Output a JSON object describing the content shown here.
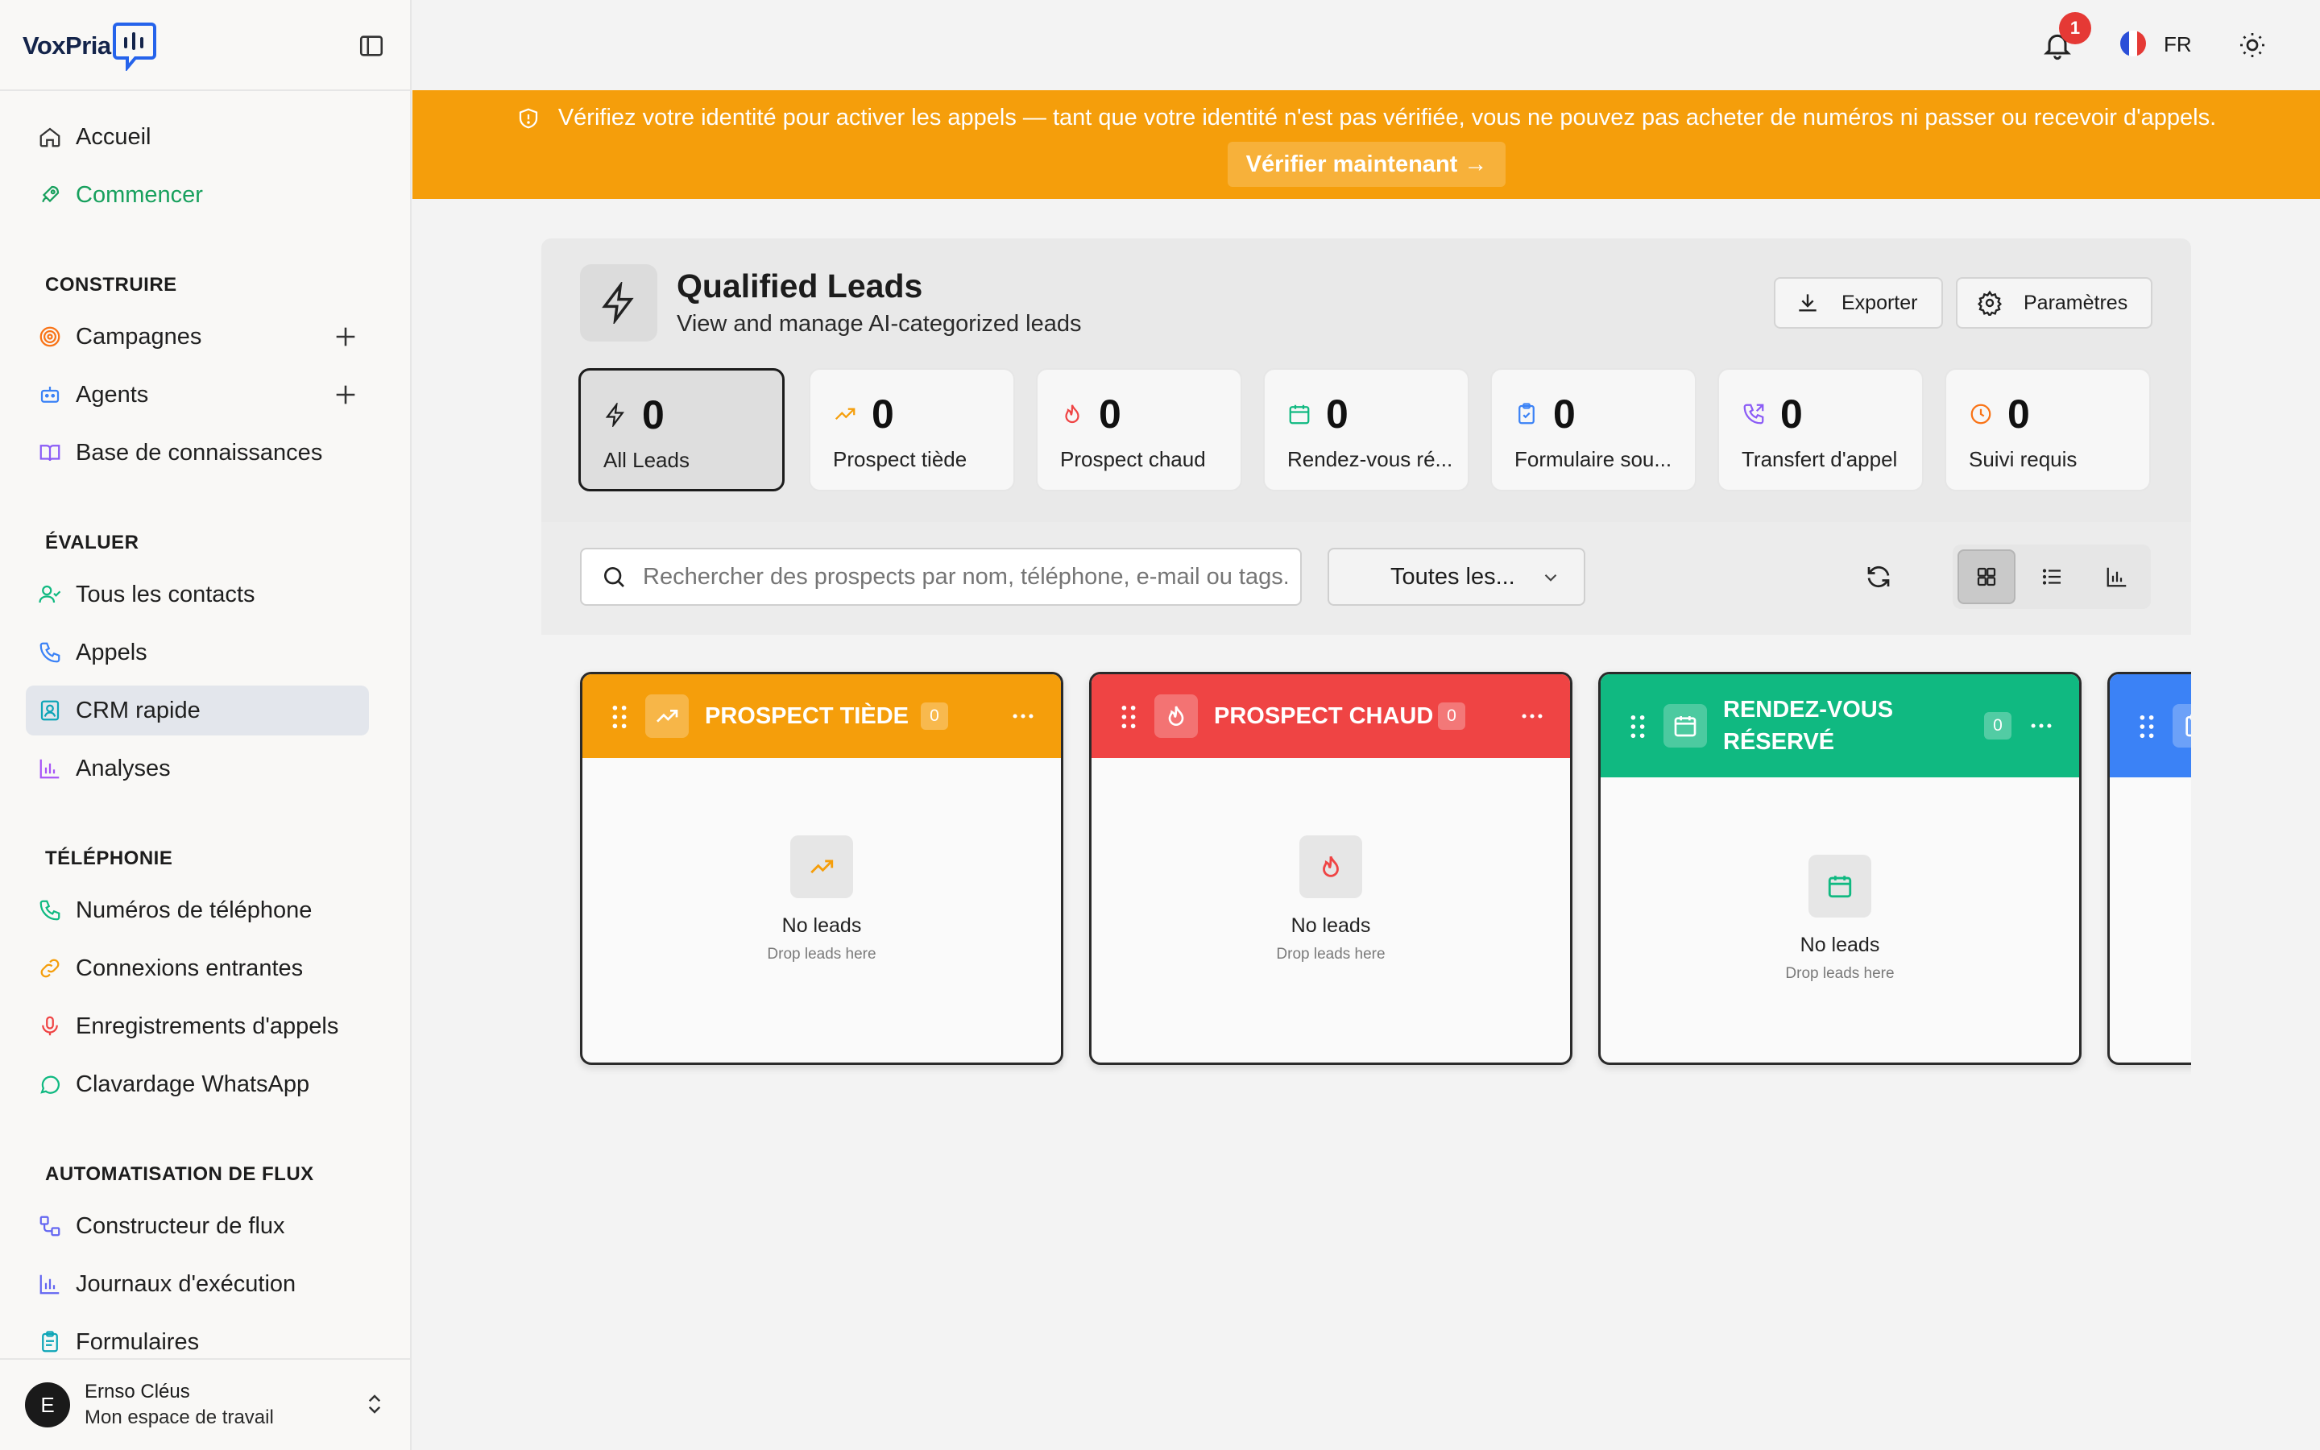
{
  "app": {
    "name": "VoxPria"
  },
  "sidebar": {
    "items_top": [
      {
        "label": "Accueil",
        "icon": "home-icon"
      },
      {
        "label": "Commencer",
        "icon": "rocket-icon"
      }
    ],
    "sections": [
      {
        "title": "CONSTRUIRE",
        "items": [
          {
            "label": "Campagnes",
            "icon": "target-icon"
          },
          {
            "label": "Agents",
            "icon": "bot-icon"
          },
          {
            "label": "Base de connaissances",
            "icon": "book-icon"
          }
        ]
      },
      {
        "title": "ÉVALUER",
        "items": [
          {
            "label": "Tous les contacts",
            "icon": "user-check-icon"
          },
          {
            "label": "Appels",
            "icon": "phone-icon"
          },
          {
            "label": "CRM rapide",
            "icon": "contact-card-icon"
          },
          {
            "label": "Analyses",
            "icon": "bar-chart-icon"
          }
        ]
      },
      {
        "title": "TÉLÉPHONIE",
        "items": [
          {
            "label": "Numéros de téléphone",
            "icon": "phone-icon"
          },
          {
            "label": "Connexions entrantes",
            "icon": "link-icon"
          },
          {
            "label": "Enregistrements d'appels",
            "icon": "mic-icon"
          },
          {
            "label": "Clavardage WhatsApp",
            "icon": "chat-bubble-icon"
          }
        ]
      },
      {
        "title": "AUTOMATISATION DE FLUX",
        "items": [
          {
            "label": "Constructeur de flux",
            "icon": "workflow-icon"
          },
          {
            "label": "Journaux d'exécution",
            "icon": "bar-chart-icon"
          },
          {
            "label": "Formulaires",
            "icon": "clipboard-icon"
          }
        ]
      }
    ],
    "active": "CRM rapide",
    "user": {
      "initial": "E",
      "name": "Ernso Cléus",
      "workspace": "Mon espace de travail"
    }
  },
  "topbar": {
    "notifications": "1",
    "language": "FR"
  },
  "banner": {
    "text": "Vérifiez votre identité pour activer les appels — tant que votre identité n'est pas vérifiée, vous ne pouvez pas acheter de numéros ni passer ou recevoir d'appels.",
    "button": "Vérifier maintenant →",
    "color": "#f59e0b"
  },
  "header": {
    "title": "Qualified Leads",
    "subtitle": "View and manage AI-categorized leads",
    "export_label": "Exporter",
    "settings_label": "Paramètres"
  },
  "stats": [
    {
      "count": "0",
      "label": "All Leads",
      "icon": "lightning-icon",
      "color": "#1c1c1c"
    },
    {
      "count": "0",
      "label": "Prospect tiède",
      "icon": "trending-up-icon",
      "color": "#f59e0b"
    },
    {
      "count": "0",
      "label": "Prospect chaud",
      "icon": "flame-icon",
      "color": "#ef4444"
    },
    {
      "count": "0",
      "label": "Rendez-vous ré...",
      "icon": "calendar-icon",
      "color": "#10b981"
    },
    {
      "count": "0",
      "label": "Formulaire sou...",
      "icon": "clipboard-check-icon",
      "color": "#3b82f6"
    },
    {
      "count": "0",
      "label": "Transfert d'appel",
      "icon": "phone-forward-icon",
      "color": "#8b5cf6"
    },
    {
      "count": "0",
      "label": "Suivi requis",
      "icon": "clock-icon",
      "color": "#f97316"
    }
  ],
  "filters": {
    "search_placeholder": "Rechercher des prospects par nom, téléphone, e-mail ou tags...",
    "select_value": "Toutes les..."
  },
  "columns": [
    {
      "title": "PROSPECT TIÈDE",
      "count": "0",
      "color": "#f59e0b",
      "icon": "trending-up-icon",
      "empty_title": "No leads",
      "empty_sub": "Drop leads here"
    },
    {
      "title": "PROSPECT CHAUD",
      "count": "0",
      "color": "#ef4444",
      "icon": "flame-icon",
      "empty_title": "No leads",
      "empty_sub": "Drop leads here"
    },
    {
      "title_line1": "RENDEZ-VOUS",
      "title_line2": "RÉSERVÉ",
      "count": "0",
      "color": "#10b981",
      "icon": "calendar-icon",
      "empty_title": "No leads",
      "empty_sub": "Drop leads here"
    },
    {
      "color": "#3b82f6",
      "icon": "clipboard-icon"
    }
  ]
}
